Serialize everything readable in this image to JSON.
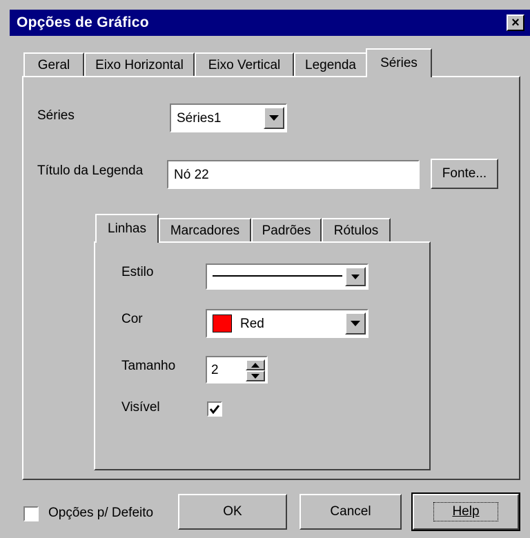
{
  "window": {
    "title": "Opções de Gráfico",
    "close_glyph": "×"
  },
  "tabs": [
    "Geral",
    "Eixo Horizontal",
    "Eixo Vertical",
    "Legenda",
    "Séries"
  ],
  "active_tab": "Séries",
  "series_section": {
    "series_label": "Séries",
    "series_value": "Séries1",
    "legend_title_label": "Título da Legenda",
    "legend_title_value": "Nó 22",
    "font_button": "Fonte..."
  },
  "sub_tabs": [
    "Linhas",
    "Marcadores",
    "Padrões",
    "Rótulos"
  ],
  "active_sub_tab": "Linhas",
  "lines": {
    "style_label": "Estilo",
    "color_label": "Cor",
    "color_value": "Red",
    "color_swatch": "#ff0000",
    "size_label": "Tamanho",
    "size_value": "2",
    "visible_label": "Visível",
    "visible_checked": true
  },
  "footer": {
    "default_checkbox_label": "Opções p/ Defeito",
    "default_checked": false,
    "ok": "OK",
    "cancel": "Cancel",
    "help": "Help"
  }
}
